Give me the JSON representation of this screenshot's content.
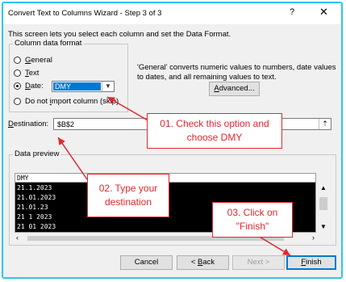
{
  "window": {
    "title": "Convert Text to Columns Wizard - Step 3 of 3",
    "help": "?",
    "close": "✕"
  },
  "intro_text": "This screen lets you select each column and set the Data Format.",
  "column_data_format": {
    "label": "Column data format",
    "options": [
      {
        "key": "G",
        "rest": "eneral",
        "selected": false
      },
      {
        "key": "T",
        "rest": "ext",
        "selected": false
      },
      {
        "key": "D",
        "rest": "ate:",
        "selected": true
      },
      {
        "pre": "Do not ",
        "key": "i",
        "rest": "mport column (skip)",
        "selected": false
      }
    ],
    "date_format": "DMY"
  },
  "general_note_line1": "'General' converts numeric values to numbers, date values",
  "general_note_line2": "to dates, and all remaining values to text.",
  "advanced_button": {
    "pre": "",
    "key": "A",
    "rest": "dvanced..."
  },
  "destination": {
    "key": "D",
    "rest": "estination:",
    "value": "$B$2"
  },
  "data_preview": {
    "label": "Data preview",
    "header": "DMY",
    "rows": [
      "21.1.2023",
      "21.01.2023",
      "21.01.23",
      "21 1 2023",
      "21 01 2023"
    ]
  },
  "buttons": {
    "cancel": "Cancel",
    "back": {
      "pre": "< ",
      "key": "B",
      "rest": "ack"
    },
    "next": "Next >",
    "finish": {
      "key": "F",
      "rest": "inish"
    }
  },
  "callouts": {
    "c1_line1": "01. Check this option and",
    "c1_line2": "choose DMY",
    "c2_line1": "02. Type your",
    "c2_line2": "destination",
    "c3_line1": "03. Click on",
    "c3_line2": "\"Finish\""
  },
  "colors": {
    "frame": "#2ec4f1",
    "callout": "#e0282d",
    "selection": "#0078d7"
  }
}
